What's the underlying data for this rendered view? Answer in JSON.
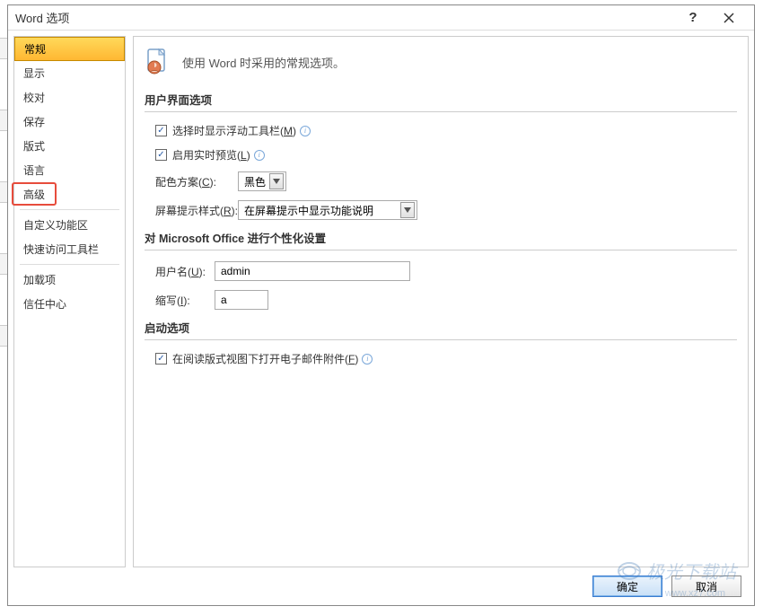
{
  "dialog": {
    "title": "Word 选项",
    "help_tooltip": "?",
    "close_tooltip": "×"
  },
  "sidebar": {
    "items": [
      {
        "label": "常规",
        "selected": true
      },
      {
        "label": "显示"
      },
      {
        "label": "校对"
      },
      {
        "label": "保存"
      },
      {
        "label": "版式"
      },
      {
        "label": "语言"
      },
      {
        "label": "高级"
      },
      {
        "sep": true
      },
      {
        "label": "自定义功能区"
      },
      {
        "label": "快速访问工具栏"
      },
      {
        "sep": true
      },
      {
        "label": "加载项"
      },
      {
        "label": "信任中心"
      }
    ]
  },
  "header": {
    "description": "使用 Word 时采用的常规选项。"
  },
  "sections": {
    "ui": {
      "title": "用户界面选项",
      "mini_toolbar_label": "选择时显示浮动工具栏(M)",
      "mini_toolbar_checked": true,
      "live_preview_label": "启用实时预览(L)",
      "live_preview_checked": true,
      "color_scheme_label": "配色方案(C):",
      "color_scheme_value": "黑色",
      "screentip_label": "屏幕提示样式(R):",
      "screentip_value": "在屏幕提示中显示功能说明"
    },
    "personalize": {
      "title": "对 Microsoft Office 进行个性化设置",
      "username_label": "用户名(U):",
      "username_value": "admin",
      "initials_label": "缩写(I):",
      "initials_value": "a"
    },
    "startup": {
      "title": "启动选项",
      "reading_view_label": "在阅读版式视图下打开电子邮件附件(F)",
      "reading_view_checked": true
    }
  },
  "footer": {
    "ok": "确定",
    "cancel": "取消"
  },
  "watermark": {
    "text": "极光下载站",
    "url": "www.xz7.com"
  }
}
